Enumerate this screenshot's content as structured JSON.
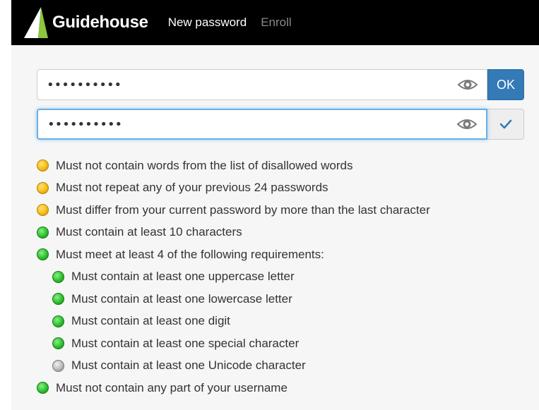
{
  "header": {
    "brand_name": "Guidehouse",
    "logo_icon": "guidehouse-logo",
    "nav": [
      {
        "label": "New password",
        "state": "active"
      },
      {
        "label": "Enroll",
        "state": "inactive"
      }
    ]
  },
  "form": {
    "new_password": {
      "value": "••••••••••",
      "icon": "eye-icon"
    },
    "confirm_password": {
      "value": "••••••••••",
      "icon": "eye-icon",
      "focused": true
    },
    "ok_label": "OK",
    "confirm_status_icon": "checkmark-icon"
  },
  "colors": {
    "header_bg": "#000000",
    "ok_button": "#337ab7",
    "focus_border": "#66afe9",
    "check": "#337ab7",
    "status_yellow": "#f6bb18",
    "status_green": "#2fbf2f",
    "status_gray": "#b9b9b9"
  },
  "requirements": [
    {
      "text": "Must not contain words from the list of disallowed words",
      "status": "yellow"
    },
    {
      "text": "Must not repeat any of your previous 24 passwords",
      "status": "yellow"
    },
    {
      "text": "Must differ from your current password by more than the last character",
      "status": "yellow"
    },
    {
      "text": "Must contain at least 10 characters",
      "status": "green"
    },
    {
      "text": "Must meet at least 4 of the following requirements:",
      "status": "green"
    },
    {
      "text": "Must contain at least one uppercase letter",
      "status": "green",
      "sub": true
    },
    {
      "text": "Must contain at least one lowercase letter",
      "status": "green",
      "sub": true
    },
    {
      "text": "Must contain at least one digit",
      "status": "green",
      "sub": true
    },
    {
      "text": "Must contain at least one special character",
      "status": "green",
      "sub": true
    },
    {
      "text": "Must contain at least one Unicode character",
      "status": "gray",
      "sub": true
    },
    {
      "text": "Must not contain any part of your username",
      "status": "green"
    }
  ]
}
